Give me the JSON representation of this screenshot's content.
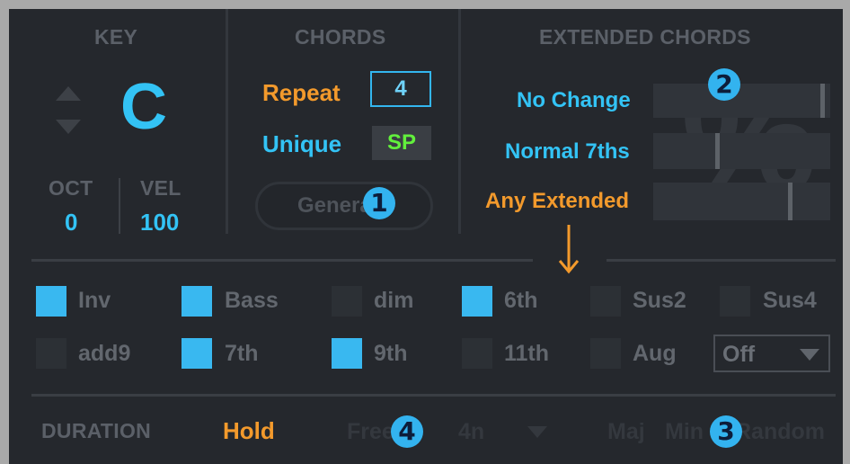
{
  "key": {
    "header": "KEY",
    "value": "C",
    "oct_label": "OCT",
    "oct_value": "0",
    "vel_label": "VEL",
    "vel_value": "100"
  },
  "chords": {
    "header": "CHORDS",
    "repeat_label": "Repeat",
    "repeat_value": "4",
    "unique_label": "Unique",
    "unique_value": "SP",
    "generate_label": "Generate"
  },
  "extended": {
    "header": "EXTENDED CHORDS",
    "rows": [
      {
        "label": "No Change",
        "level": 0.97
      },
      {
        "label": "Normal 7ths",
        "level": 0.36
      },
      {
        "label": "Any Extended",
        "level": 0.78
      }
    ],
    "percent_symbol": "%"
  },
  "options": {
    "row1": [
      {
        "label": "Inv",
        "checked": true
      },
      {
        "label": "Bass",
        "checked": true
      },
      {
        "label": "dim",
        "checked": false
      },
      {
        "label": "6th",
        "checked": true
      },
      {
        "label": "Sus2",
        "checked": false
      },
      {
        "label": "Sus4",
        "checked": false
      }
    ],
    "row2": [
      {
        "label": "add9",
        "checked": false
      },
      {
        "label": "7th",
        "checked": true
      },
      {
        "label": "9th",
        "checked": true
      },
      {
        "label": "11th",
        "checked": false
      },
      {
        "label": "Aug",
        "checked": false
      }
    ],
    "dropdown_value": "Off"
  },
  "duration": {
    "label": "DURATION",
    "hold": "Hold",
    "free": "Free",
    "note": "4n",
    "maj": "Maj",
    "min": "Min",
    "random": "Random"
  },
  "badges": [
    "1",
    "2",
    "3",
    "4"
  ],
  "colors": {
    "accent_blue": "#33c3f5",
    "accent_orange": "#f39a2c",
    "accent_green": "#62f03c",
    "background": "#25282d"
  }
}
